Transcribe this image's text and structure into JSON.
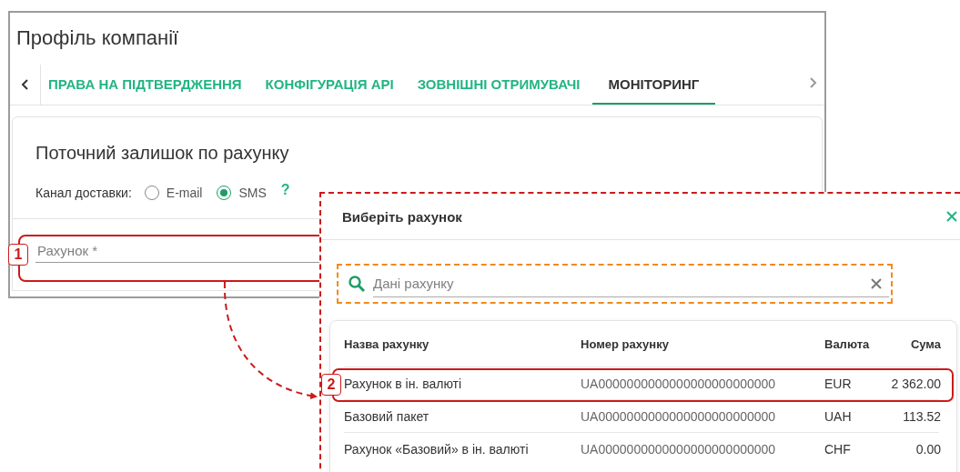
{
  "window": {
    "title": "Профіль компанії"
  },
  "tabs": [
    {
      "label": "ПРАВА НА ПІДТВЕРДЖЕННЯ",
      "selected": false
    },
    {
      "label": "КОНФІГУРАЦІЯ API",
      "selected": false
    },
    {
      "label": "ЗОВНІШНІ ОТРИМУВАЧІ",
      "selected": false
    },
    {
      "label": "МОНІТОРИНГ",
      "selected": true
    }
  ],
  "section": {
    "title": "Поточний залишок по рахунку",
    "delivery_label": "Канал доставки:",
    "help": "?",
    "options": [
      {
        "label": "E-mail",
        "selected": false
      },
      {
        "label": "SMS",
        "selected": true
      }
    ]
  },
  "account_field": {
    "placeholder": "Рахунок *"
  },
  "dialog": {
    "title": "Виберіть рахунок",
    "search": {
      "placeholder": "Дані рахунку"
    },
    "table": {
      "columns": [
        "Назва рахунку",
        "Номер рахунку",
        "Валюта",
        "Сума"
      ],
      "rows": [
        {
          "cells": [
            "Рахунок в ін. валюті",
            "UA0000000000000000000000000",
            "EUR",
            "2 362.00"
          ]
        },
        {
          "cells": [
            "Базовий пакет",
            "UA0000000000000000000000000",
            "UAH",
            "113.52"
          ]
        },
        {
          "cells": [
            "Рахунок «Базовий» в ін. валюті",
            "UA0000000000000000000000000",
            "CHF",
            "0.00"
          ]
        }
      ]
    }
  },
  "annotations": [
    {
      "label": "1"
    },
    {
      "label": "2"
    }
  ]
}
